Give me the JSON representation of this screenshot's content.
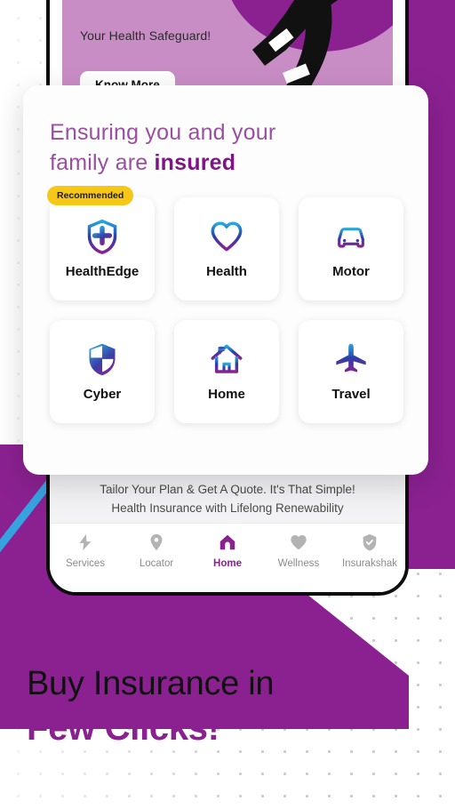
{
  "background": {
    "brand_purple": "#8B2191",
    "accent_blue": "#36A3E0",
    "badge_yellow": "#F7C718"
  },
  "phone": {
    "promo": {
      "line1": "Your Health Safeguard!",
      "button_label": "Know More"
    },
    "tailor": {
      "line1": "Tailor Your Plan & Get A Quote. It's That Simple!",
      "line2": "Health Insurance with Lifelong Renewability"
    },
    "bottom_nav": [
      {
        "label": "Services",
        "icon": "lightning-bolt-icon",
        "active": false
      },
      {
        "label": "Locator",
        "icon": "map-pin-icon",
        "active": false
      },
      {
        "label": "Home",
        "icon": "home-icon",
        "active": true
      },
      {
        "label": "Wellness",
        "icon": "heart-icon",
        "active": false
      },
      {
        "label": "Insurakshak",
        "icon": "shield-check-icon",
        "active": false
      }
    ]
  },
  "overlay": {
    "title_line1": "Ensuring you and your",
    "title_line2_prefix": "family are ",
    "title_line2_strong": "insured",
    "tiles": [
      {
        "label": "HealthEdge",
        "icon": "shield-cross-icon",
        "badge": "Recommended"
      },
      {
        "label": "Health",
        "icon": "heart-outline-icon",
        "badge": ""
      },
      {
        "label": "Motor",
        "icon": "car-icon",
        "badge": ""
      },
      {
        "label": "Cyber",
        "icon": "shield-quarters-icon",
        "badge": ""
      },
      {
        "label": "Home",
        "icon": "house-outline-icon",
        "badge": ""
      },
      {
        "label": "Travel",
        "icon": "airplane-icon",
        "badge": ""
      }
    ]
  },
  "headline": {
    "line1": "Buy Insurance in",
    "line2": "Few Clicks!"
  }
}
